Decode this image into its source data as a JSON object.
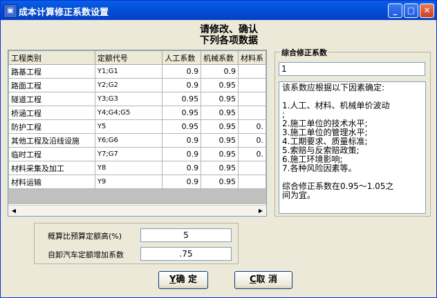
{
  "window": {
    "title": "成本计算修正系数设置"
  },
  "header": {
    "line1": "请修改、确认",
    "line2": "下列各项数据"
  },
  "grid": {
    "columns": [
      "工程类别",
      "定额代号",
      "人工系数",
      "机械系数",
      "材料系"
    ],
    "rows": [
      [
        "路基工程",
        "Y1;G1",
        "0.9",
        "0.9",
        ""
      ],
      [
        "路面工程",
        "Y2;G2",
        "0.9",
        "0.95",
        ""
      ],
      [
        "隧道工程",
        "Y3;G3",
        "0.95",
        "0.95",
        ""
      ],
      [
        "桥涵工程",
        "Y4;G4;G5",
        "0.95",
        "0.95",
        ""
      ],
      [
        "防护工程",
        "Y5",
        "0.95",
        "0.95",
        "0."
      ],
      [
        "其他工程及沿线设施",
        "Y6;G6",
        "0.9",
        "0.95",
        "0."
      ],
      [
        "临时工程",
        "Y7;G7",
        "0.9",
        "0.95",
        "0."
      ],
      [
        "材料采集及加工",
        "Y8",
        "0.9",
        "0.95",
        ""
      ],
      [
        "材料运输",
        "Y9",
        "0.9",
        "0.95",
        ""
      ]
    ]
  },
  "factor": {
    "label": "综合修正系数",
    "value": "1",
    "description": [
      "该系数应根据以下因素确定:",
      "",
      "1.人工、材料、机械单价波动",
      ";",
      "2.施工单位的技术水平;",
      "3.施工单位的管理水平;",
      "4.工期要求、质量标准;",
      "5.索赔与反索赔政策;",
      "6.施工环境影响;",
      "7.各种风险因素等。",
      "",
      "综合修正系数在0.95～1.05之",
      "间为宜。"
    ]
  },
  "settings": {
    "budget_label": "概算比预算定额高(%)",
    "budget_value": "5",
    "truck_label": "自卸汽车定额增加系数",
    "truck_value": ".75"
  },
  "buttons": {
    "ok_key": "Y",
    "ok_label": "确 定",
    "cancel_key": "C",
    "cancel_label": "取 消"
  }
}
